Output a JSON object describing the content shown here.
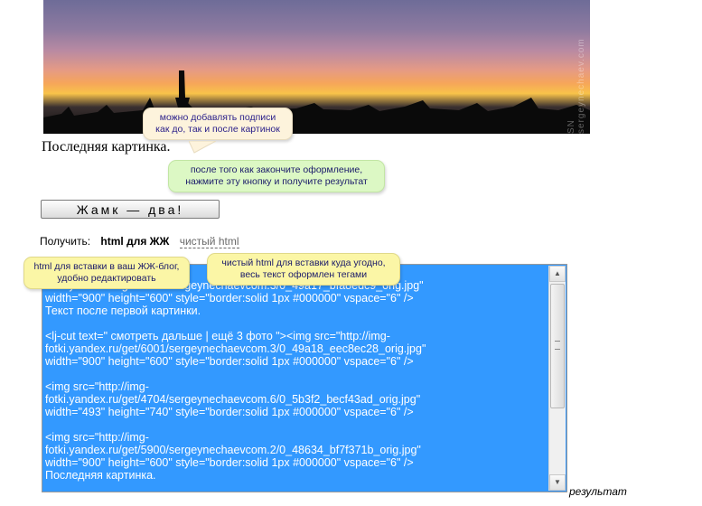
{
  "photo": {
    "watermark": "SN sergeynechaev.com"
  },
  "tooltips": {
    "captions_hint_line1": "можно добавлять подписи",
    "captions_hint_line2": "как до, так и после картинок",
    "finish_hint_line1": "после того как закончите оформление,",
    "finish_hint_line2": "нажмите эту кнопку и получите результат",
    "lj_hint_line1": "html для вставки в ваш ЖЖ-блог,",
    "lj_hint_line2": "удобно редактировать",
    "plain_hint_line1": "чистый html для вставки куда угодно,",
    "plain_hint_line2": "весь текст оформлен тегами"
  },
  "caption": "Последняя картинка.",
  "button": {
    "label": "Жамк — два!"
  },
  "get": {
    "label": "Получить:",
    "option_lj": "html для ЖЖ",
    "option_plain": "чистый html"
  },
  "output": {
    "text": "                                                    \nfotki.yandex.ru/get/5300/sergeynechaevcom.3/0_49a17_bfa8edc9_orig.jpg\"\nwidth=\"900\" height=\"600\" style=\"border:solid 1px #000000\" vspace=\"6\" />\nТекст после первой картинки.\n\n<lj-cut text=\" смотреть дальше | ещё 3 фото \"><img src=\"http://img-\nfotki.yandex.ru/get/6001/sergeynechaevcom.3/0_49a18_eec8ec28_orig.jpg\"\nwidth=\"900\" height=\"600\" style=\"border:solid 1px #000000\" vspace=\"6\" />\n\n<img src=\"http://img-\nfotki.yandex.ru/get/4704/sergeynechaevcom.6/0_5b3f2_becf43ad_orig.jpg\"\nwidth=\"493\" height=\"740\" style=\"border:solid 1px #000000\" vspace=\"6\" />\n\n<img src=\"http://img-\nfotki.yandex.ru/get/5900/sergeynechaevcom.2/0_48634_bf7f371b_orig.jpg\"\nwidth=\"900\" height=\"600\" style=\"border:solid 1px #000000\" vspace=\"6\" />\nПоследняя картинка."
  },
  "result_label": "результат",
  "colors": {
    "selection": "#3399ff",
    "tooltip_cream": "#fdf3dc",
    "tooltip_green": "#dcf8c4",
    "tooltip_yellow": "#fbf6a6"
  },
  "icons": {
    "scroll_up": "scroll-up-arrow-icon",
    "scroll_down": "scroll-down-arrow-icon"
  }
}
